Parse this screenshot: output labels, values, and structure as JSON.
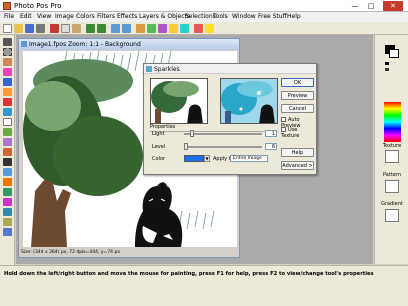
{
  "app": {
    "title": "Photo Pos Pro"
  },
  "window_buttons": {
    "minimize": "—",
    "maximize": "□",
    "close": "✕"
  },
  "menu": [
    "File",
    "Edit",
    "View",
    "Image",
    "Colors",
    "Filters",
    "Effects",
    "Layers & Objects",
    "Selections",
    "Tools",
    "Window",
    "Free Stuff",
    "Help"
  ],
  "image_window": {
    "title": "Image1.fpos  Zoom: 1:1 - Background",
    "status_size": "Size: (344 x 364) px, 72 dpi",
    "status_pos": "x=444, y=74 px"
  },
  "dialog": {
    "title": "Sparkles",
    "buttons": {
      "ok": "OK",
      "preview": "Preview",
      "cancel": "Cancel",
      "help": "Help",
      "advanced": "Advanced >"
    },
    "checkboxes": {
      "auto_preview": "Auto Preview",
      "use_texture": "Use Texture"
    },
    "properties_label": "Properties",
    "light": {
      "label": "Light",
      "value": "1",
      "level": 0.08
    },
    "level": {
      "label": "Level",
      "value": "6",
      "level": 0.0
    },
    "color": {
      "label": "Color",
      "swatch": "#1e6ef0",
      "apply_label": "Apply to",
      "apply_value": "Entire Image"
    }
  },
  "right_panel": {
    "texture_label": "Texture",
    "pattern_label": "Pattern",
    "gradient_label": "Gradient"
  },
  "status": {
    "message": "Hold down the left/right button and move the mouse for painting, press F1 for help, press F2 to view/change tool's properties"
  }
}
